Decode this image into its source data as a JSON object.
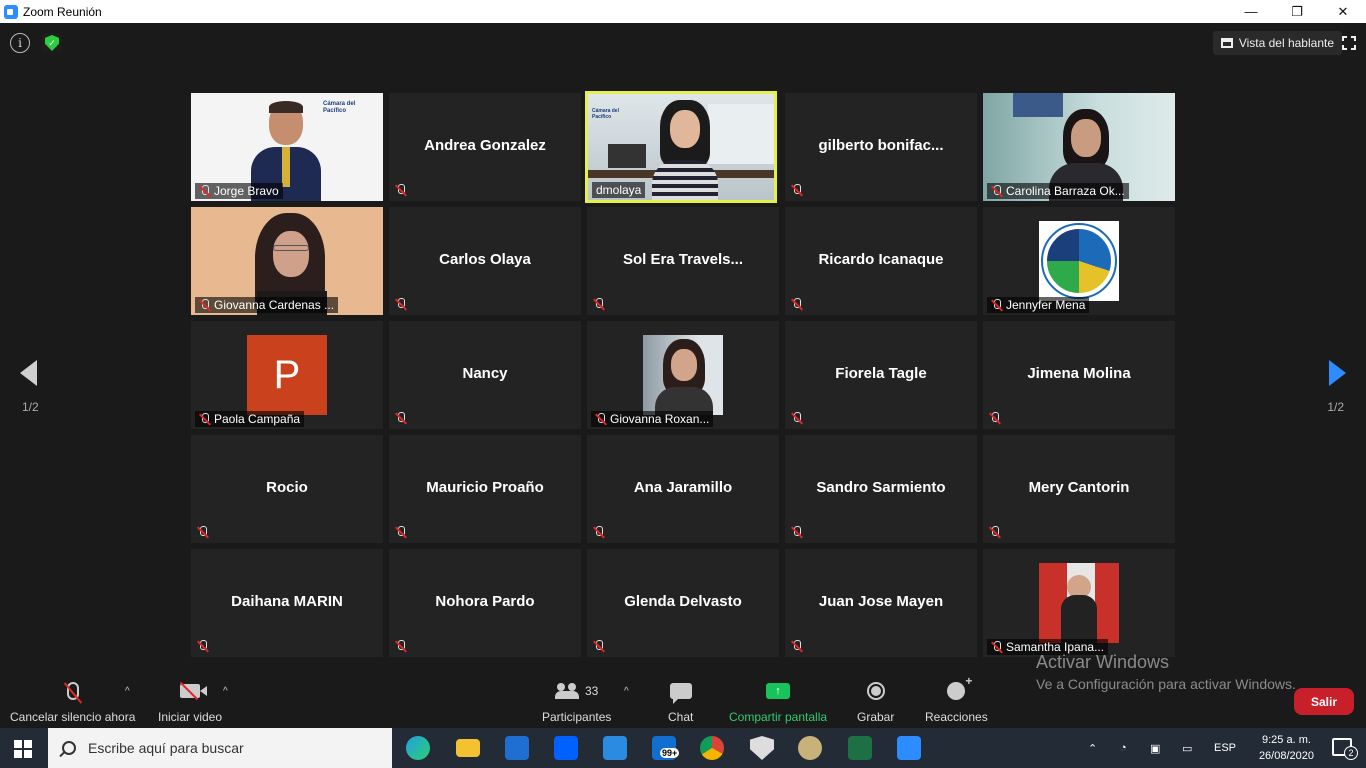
{
  "window": {
    "title": "Zoom Reunión",
    "minimize": "—",
    "maximize": "❐",
    "close": "✕"
  },
  "header": {
    "info_glyph": "i",
    "speaker_view_label": "Vista del hablante"
  },
  "pagination": {
    "left_page": "1/2",
    "right_page": "1/2"
  },
  "participants": [
    {
      "name": "Jorge Bravo",
      "video": true,
      "photo": "jorge"
    },
    {
      "name": "Andrea Gonzalez",
      "video": false
    },
    {
      "name": "dmolaya",
      "video": true,
      "photo": "dmolaya",
      "active": true
    },
    {
      "name": "gilberto  bonifac...",
      "video": false
    },
    {
      "name": "Carolina Barraza Ok...",
      "video": true,
      "photo": "carolina"
    },
    {
      "name": "Giovanna Cardenas ...",
      "video": true,
      "photo": "giovanna"
    },
    {
      "name": "Carlos Olaya",
      "video": false
    },
    {
      "name": "Sol  Era  Travels...",
      "video": false
    },
    {
      "name": "Ricardo Icanaque",
      "video": false
    },
    {
      "name": "Jennyfer Mena",
      "video": true,
      "photo": "logo"
    },
    {
      "name": "Paola Campaña",
      "video": true,
      "photo": "ppt",
      "avatar_letter": "P"
    },
    {
      "name": "Nancy",
      "video": false
    },
    {
      "name": "Giovanna Roxan...",
      "video": true,
      "photo": "roxana"
    },
    {
      "name": "Fiorela Tagle",
      "video": false
    },
    {
      "name": "Jimena Molina",
      "video": false
    },
    {
      "name": "Rocio",
      "video": false
    },
    {
      "name": "Mauricio Proaño",
      "video": false
    },
    {
      "name": "Ana Jaramillo",
      "video": false
    },
    {
      "name": "Sandro Sarmiento",
      "video": false
    },
    {
      "name": "Mery Cantorin",
      "video": false
    },
    {
      "name": "Daihana MARIN",
      "video": false
    },
    {
      "name": "Nohora Pardo",
      "video": false
    },
    {
      "name": "Glenda Delvasto",
      "video": false
    },
    {
      "name": "Juan Jose Mayen",
      "video": false
    },
    {
      "name": "Samantha Ipana...",
      "video": true,
      "photo": "samantha"
    }
  ],
  "toolbar": {
    "unmute_label": "Cancelar silencio ahora",
    "video_label": "Iniciar video",
    "participants_label": "Participantes",
    "participants_count": "33",
    "chat_label": "Chat",
    "share_label": "Compartir pantalla",
    "record_label": "Grabar",
    "reactions_label": "Reacciones",
    "leave_label": "Salir",
    "caret": "^"
  },
  "watermark": {
    "line1": "Activar Windows",
    "line2": "Ve a Configuración para activar Windows."
  },
  "taskbar": {
    "search_placeholder": "Escribe aquí para buscar",
    "badge": "99+",
    "language": "ESP",
    "time": "9:25 a. m.",
    "date": "26/08/2020",
    "notifications": "2"
  },
  "logo_text": {
    "line1": "Cámara del",
    "line2": "Pacífico"
  }
}
